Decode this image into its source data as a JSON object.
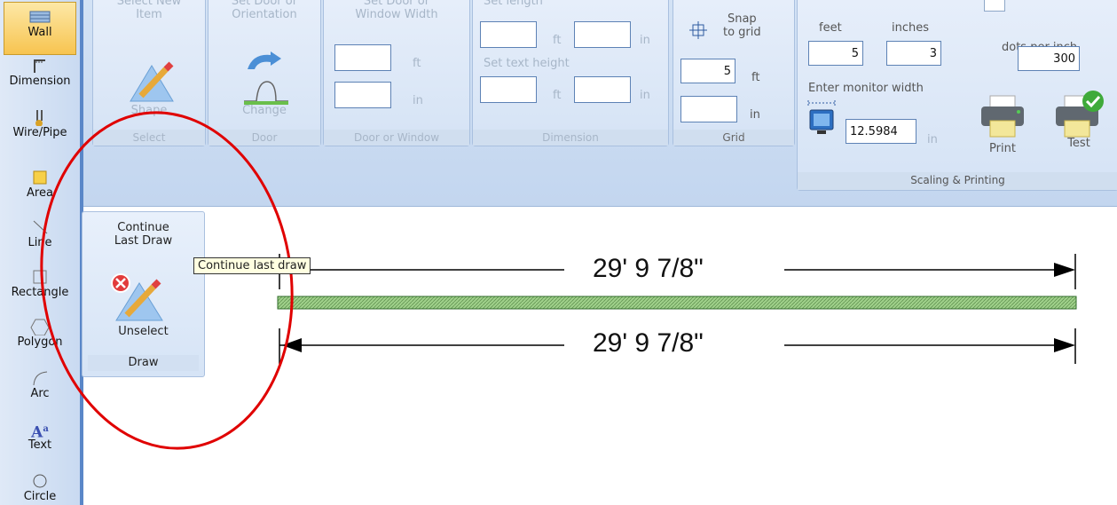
{
  "palette": {
    "tools": [
      {
        "label": "Wall",
        "icon": "wall-icon"
      },
      {
        "label": "Dimension",
        "icon": "dimension-icon"
      },
      {
        "label": "Wire/Pipe",
        "icon": "wire-pipe-icon"
      },
      {
        "label": "Area",
        "icon": "area-icon"
      },
      {
        "label": "Line",
        "icon": "line-icon"
      },
      {
        "label": "Rectangle",
        "icon": "rectangle-icon"
      },
      {
        "label": "Polygon",
        "icon": "polygon-icon"
      },
      {
        "label": "Arc",
        "icon": "arc-icon"
      },
      {
        "label": "Text",
        "icon": "text-icon"
      },
      {
        "label": "Circle",
        "icon": "circle-icon"
      }
    ],
    "active_tool": "Wall"
  },
  "ribbon": {
    "select": {
      "line1": "Select New",
      "line2": "Item",
      "button": "Shape",
      "footer": "Select"
    },
    "door": {
      "line1": "Set Door or",
      "line2": "Orientation",
      "button": "Change",
      "footer": "Door"
    },
    "door_window": {
      "line1": "Set Door or",
      "line2": "Window Width",
      "unit_ft": "ft",
      "unit_in": "in",
      "footer": "Door or Window"
    },
    "dimension": {
      "length_label": "Set length",
      "text_height_label": "Set text height",
      "unit_ft": "ft",
      "unit_in": "in",
      "footer": "Dimension"
    },
    "grid": {
      "snap_line1": "Snap",
      "snap_line2": "to grid",
      "feet_value": "5",
      "unit_ft": "ft",
      "unit_in": "in",
      "footer": "Grid"
    },
    "scaling": {
      "feet_label": "feet",
      "inches_label": "inches",
      "feet_value": "5",
      "inches_value": "3",
      "dpi_label": "dots per inch",
      "dpi_value": "300",
      "monitor_label": "Enter monitor width",
      "monitor_value": "12.5984",
      "monitor_unit": "in",
      "print_label": "Print",
      "test_label": "Test",
      "footer": "Scaling & Printing"
    }
  },
  "draw_panel": {
    "line1": "Continue",
    "line2": "Last Draw",
    "button": "Unselect",
    "footer": "Draw"
  },
  "tooltip": "Continue last draw",
  "drawing": {
    "dim_top": "29' 9 7/8\"",
    "dim_bottom": "29' 9 7/8\""
  },
  "colors": {
    "wall_fill": "#9fd08a",
    "annotation": "#e00000",
    "ribbon": "#c3d6ef"
  }
}
